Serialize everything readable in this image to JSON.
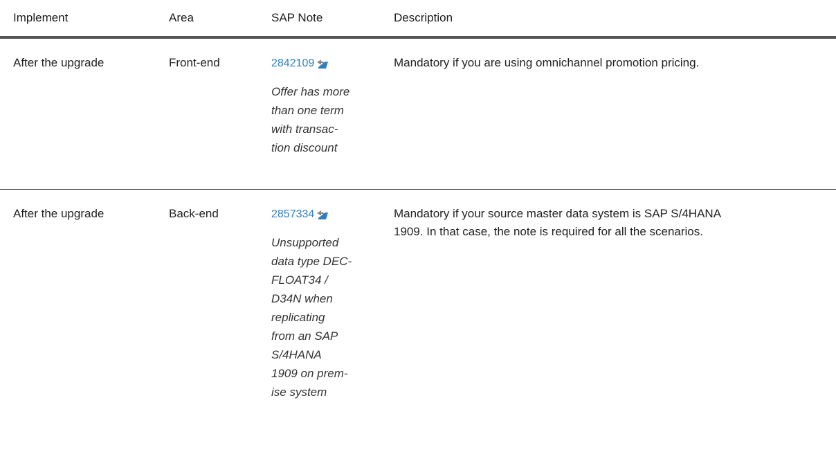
{
  "headers": {
    "implement": "Implement",
    "area": "Area",
    "sap_note": "SAP Note",
    "description": "Description"
  },
  "rows": [
    {
      "implement": "After the upgrade",
      "area": "Front-end",
      "note_number": "2842109",
      "note_title_lines": [
        "Offer has more",
        "than one term",
        "with transac-",
        "tion discount"
      ],
      "description": "Mandatory if you are using omnichannel promotion pricing."
    },
    {
      "implement": "After the upgrade",
      "area": "Back-end",
      "note_number": "2857334",
      "note_title_lines": [
        "Unsupported",
        "data type DEC-",
        "FLOAT34 /",
        "D34N when",
        "replicating",
        "from an SAP",
        "S/4HANA",
        "1909 on prem-",
        "ise system"
      ],
      "description_lines": [
        "Mandatory if your source master data system is SAP S/4HANA",
        "1909. In that case, the note is required for all the scenarios."
      ]
    }
  ],
  "icons": {
    "external_link": "external-link-icon"
  },
  "colors": {
    "link": "#2d7fc1",
    "header_rule": "#555555",
    "row_rule": "#333333"
  }
}
